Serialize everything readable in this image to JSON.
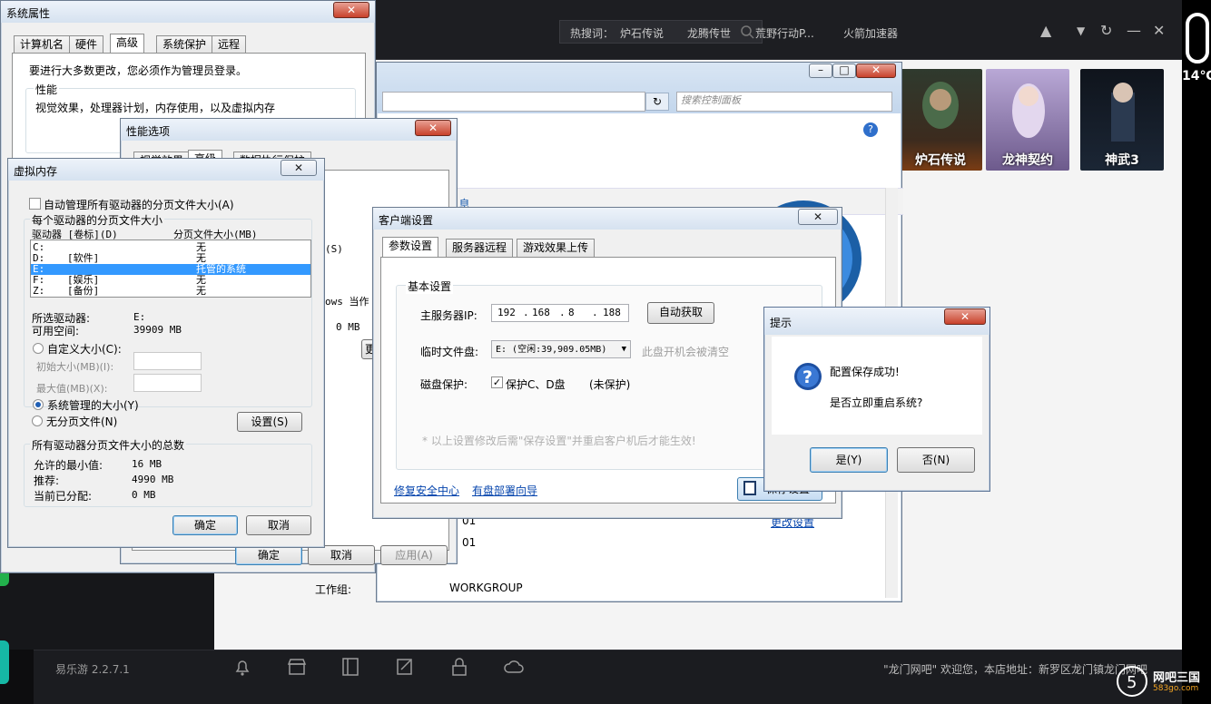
{
  "launcher": {
    "hot_label": "热搜词：",
    "hot_words": [
      "炉石传说",
      "龙腾传世",
      "荒野行动P...",
      "火箭加速器"
    ],
    "games": [
      {
        "name": "炉石传说",
        "color": "#3c2b1e"
      },
      {
        "name": "龙神契约",
        "color": "#6d5a8c"
      },
      {
        "name": "神武3",
        "color": "#1b2635"
      }
    ],
    "version": "易乐游 2.2.7.1",
    "welcome": "\"龙门网吧\" 欢迎您，本店地址：新罗区龙门镇龙门网吧",
    "weather": "14℃",
    "watermark_title": "网吧三国",
    "watermark_url": "583go.com"
  },
  "control_panel": {
    "search_placeholder": "搜索控制面板",
    "workgroup_label": "工作组:",
    "workgroup_value": "WORKGROUP",
    "frag1": "01",
    "frag2": "01",
    "change_settings": "更改设置"
  },
  "sysprop": {
    "title": "系统属性",
    "tabs": [
      "计算机名",
      "硬件",
      "高级",
      "系统保护",
      "远程"
    ],
    "admin_note": "要进行大多数更改，您必须作为管理员登录。",
    "perf_title": "性能",
    "perf_desc": "视觉效果，处理器计划，内存使用，以及虚拟内存",
    "ok": "确定",
    "cancel": "取消",
    "apply": "应用(A)"
  },
  "perf": {
    "title": "性能选项",
    "tabs": [
      "视觉效果",
      "高级",
      "数据执行保护"
    ]
  },
  "vmem": {
    "title": "虚拟内存",
    "auto_manage": "自动管理所有驱动器的分页文件大小(A)",
    "per_drive": "每个驱动器的分页文件大小",
    "col_drive": "驱动器 [卷标](D)",
    "col_size": "分页文件大小(MB)",
    "drives": [
      {
        "drive": "C:",
        "label": "",
        "size": "无"
      },
      {
        "drive": "D:",
        "label": "[软件]",
        "size": "无"
      },
      {
        "drive": "E:",
        "label": "",
        "size": "托管的系统"
      },
      {
        "drive": "F:",
        "label": "[娱乐]",
        "size": "无"
      },
      {
        "drive": "Z:",
        "label": "[备份]",
        "size": "无"
      }
    ],
    "selected_drive_label": "所选驱动器:",
    "selected_drive": "E:",
    "free_label": "可用空间:",
    "free": "39909 MB",
    "custom": "自定义大小(C):",
    "initial": "初始大小(MB)(I):",
    "max": "最大值(MB)(X):",
    "system_managed": "系统管理的大小(Y)",
    "no_paging": "无分页文件(N)",
    "set": "设置(S)",
    "total_title": "所有驱动器分页文件大小的总数",
    "min_label": "允许的最小值:",
    "min": "16 MB",
    "rec_label": "推荐:",
    "rec": "4990 MB",
    "cur_label": "当前已分配:",
    "cur": "0 MB",
    "ok": "确定",
    "cancel": "取消"
  },
  "perf_bits": {
    "s": "(S)",
    "ws": "ows 当作",
    "mb": "0 MB",
    "change": "更"
  },
  "client": {
    "title": "客户端设置",
    "tabs": [
      "参数设置",
      "服务器远程",
      "游戏效果上传"
    ],
    "basic": "基本设置",
    "server_ip_label": "主服务器IP:",
    "ip": [
      "192",
      "168",
      "8",
      "188"
    ],
    "auto_get": "自动获取",
    "temp_disk_label": "临时文件盘:",
    "temp_disk": "E: (空闲:39,909.05MB)",
    "temp_note": "此盘开机会被清空",
    "protect_label": "磁盘保护:",
    "protect_opt": "保护C、D盘",
    "protect_status": "(未保护)",
    "footnote": "* 以上设置修改后需\"保存设置\"并重启客户机后才能生效!",
    "link_repair": "修复安全中心",
    "link_guide": "有盘部署向导",
    "save": "保存设置"
  },
  "prompt": {
    "title": "提示",
    "line1": "配置保存成功!",
    "line2": "是否立即重启系统?",
    "yes": "是(Y)",
    "no": "否(N)"
  }
}
